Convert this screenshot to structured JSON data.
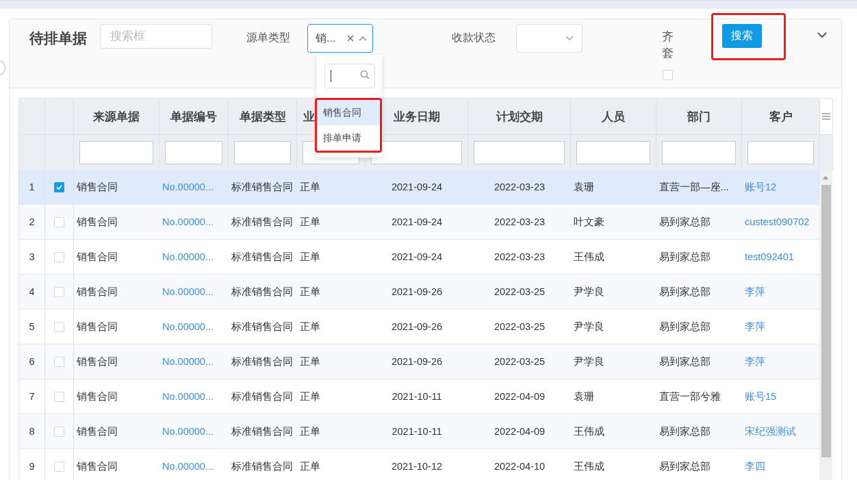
{
  "title": "待排单据",
  "search": {
    "placeholder": "搜索框"
  },
  "source_type": {
    "label": "源单类型",
    "value": "销...",
    "expanded": true
  },
  "payment_status": {
    "label": "收款状态",
    "expanded": false
  },
  "complete_set": {
    "label": "齐套",
    "checked": false
  },
  "search_button": "搜索",
  "dropdown": {
    "options": [
      {
        "label": "销售合同",
        "selected": true
      },
      {
        "label": "排单申请",
        "selected": false
      }
    ]
  },
  "table": {
    "columns": [
      {
        "label": "来源单据",
        "kind": "text"
      },
      {
        "label": "单据编号",
        "kind": "link"
      },
      {
        "label": "单据类型",
        "kind": "text"
      },
      {
        "label": "业",
        "kind": "text"
      },
      {
        "label": "业务日期",
        "kind": "center"
      },
      {
        "label": "计划交期",
        "kind": "center"
      },
      {
        "label": "人员",
        "kind": "text"
      },
      {
        "label": "部门",
        "kind": "text"
      },
      {
        "label": "客户",
        "kind": "link"
      }
    ],
    "rows": [
      {
        "index": "1",
        "checked": true,
        "selected": true,
        "cells": [
          "销售合同",
          "No.00000...",
          "标准销售合同",
          "正单",
          "2021-09-24",
          "2022-03-23",
          "袁珊",
          "直营一部—座...",
          "账号12"
        ]
      },
      {
        "index": "2",
        "checked": false,
        "selected": false,
        "cells": [
          "销售合同",
          "No.00000...",
          "标准销售合同",
          "正单",
          "2021-09-24",
          "2022-03-23",
          "叶文豪",
          "易到家总部",
          "custest090702"
        ]
      },
      {
        "index": "3",
        "checked": false,
        "selected": false,
        "cells": [
          "销售合同",
          "No.00000...",
          "标准销售合同",
          "正单",
          "2021-09-24",
          "2022-03-23",
          "王伟成",
          "易到家总部",
          "test092401"
        ]
      },
      {
        "index": "4",
        "checked": false,
        "selected": false,
        "cells": [
          "销售合同",
          "No.00000...",
          "标准销售合同",
          "正单",
          "2021-09-26",
          "2022-03-25",
          "尹学良",
          "易到家总部",
          "李萍"
        ]
      },
      {
        "index": "5",
        "checked": false,
        "selected": false,
        "cells": [
          "销售合同",
          "No.00000...",
          "标准销售合同",
          "正单",
          "2021-09-26",
          "2022-03-25",
          "尹学良",
          "易到家总部",
          "李萍"
        ]
      },
      {
        "index": "6",
        "checked": false,
        "selected": false,
        "cells": [
          "销售合同",
          "No.00000...",
          "标准销售合同",
          "正单",
          "2021-09-26",
          "2022-03-25",
          "尹学良",
          "易到家总部",
          "李萍"
        ]
      },
      {
        "index": "7",
        "checked": false,
        "selected": false,
        "cells": [
          "销售合同",
          "No.00000...",
          "标准销售合同",
          "正单",
          "2021-10-11",
          "2022-04-09",
          "袁珊",
          "直营一部兮雅",
          "账号15"
        ]
      },
      {
        "index": "8",
        "checked": false,
        "selected": false,
        "cells": [
          "销售合同",
          "No.00000...",
          "标准销售合同",
          "正单",
          "2021-10-11",
          "2022-04-09",
          "王伟成",
          "易到家总部",
          "宋纪强测试"
        ]
      },
      {
        "index": "9",
        "checked": false,
        "selected": false,
        "cells": [
          "销售合同",
          "No.00000...",
          "标准销售合同",
          "正单",
          "2021-10-12",
          "2022-04-10",
          "王伟成",
          "易到家总部",
          "李四"
        ]
      }
    ]
  }
}
